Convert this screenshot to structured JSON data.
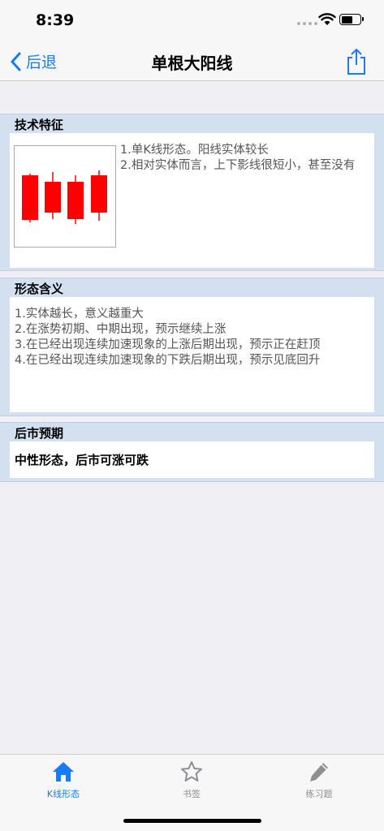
{
  "status": {
    "time": "8:39"
  },
  "nav": {
    "back_label": "后退",
    "title": "单根大阳线"
  },
  "sections": {
    "features": {
      "header": "技术特征",
      "lines": [
        "1.单K线形态。阳线实体较长",
        "2.相对实体而言，上下影线很短小，甚至没有"
      ]
    },
    "meaning": {
      "header": "形态含义",
      "lines": [
        "1.实体越长，意义越重大",
        "2.在涨势初期、中期出现，预示继续上涨",
        "3.在已经出现连续加速现象的上涨后期出现，预示正在赶顶",
        "4.在已经出现连续加速现象的下跌后期出现，预示见底回升"
      ]
    },
    "outlook": {
      "header": "后市预期",
      "text": "中性形态，后市可涨可跌"
    }
  },
  "tabs": [
    {
      "label": "K线形态",
      "icon": "home-icon",
      "active": true
    },
    {
      "label": "书签",
      "icon": "star-icon",
      "active": false
    },
    {
      "label": "练习题",
      "icon": "pencil-icon",
      "active": false
    }
  ],
  "colors": {
    "accent": "#1a7cf5",
    "candle": "#ff0000",
    "section_bg": "#d3e0f0"
  }
}
